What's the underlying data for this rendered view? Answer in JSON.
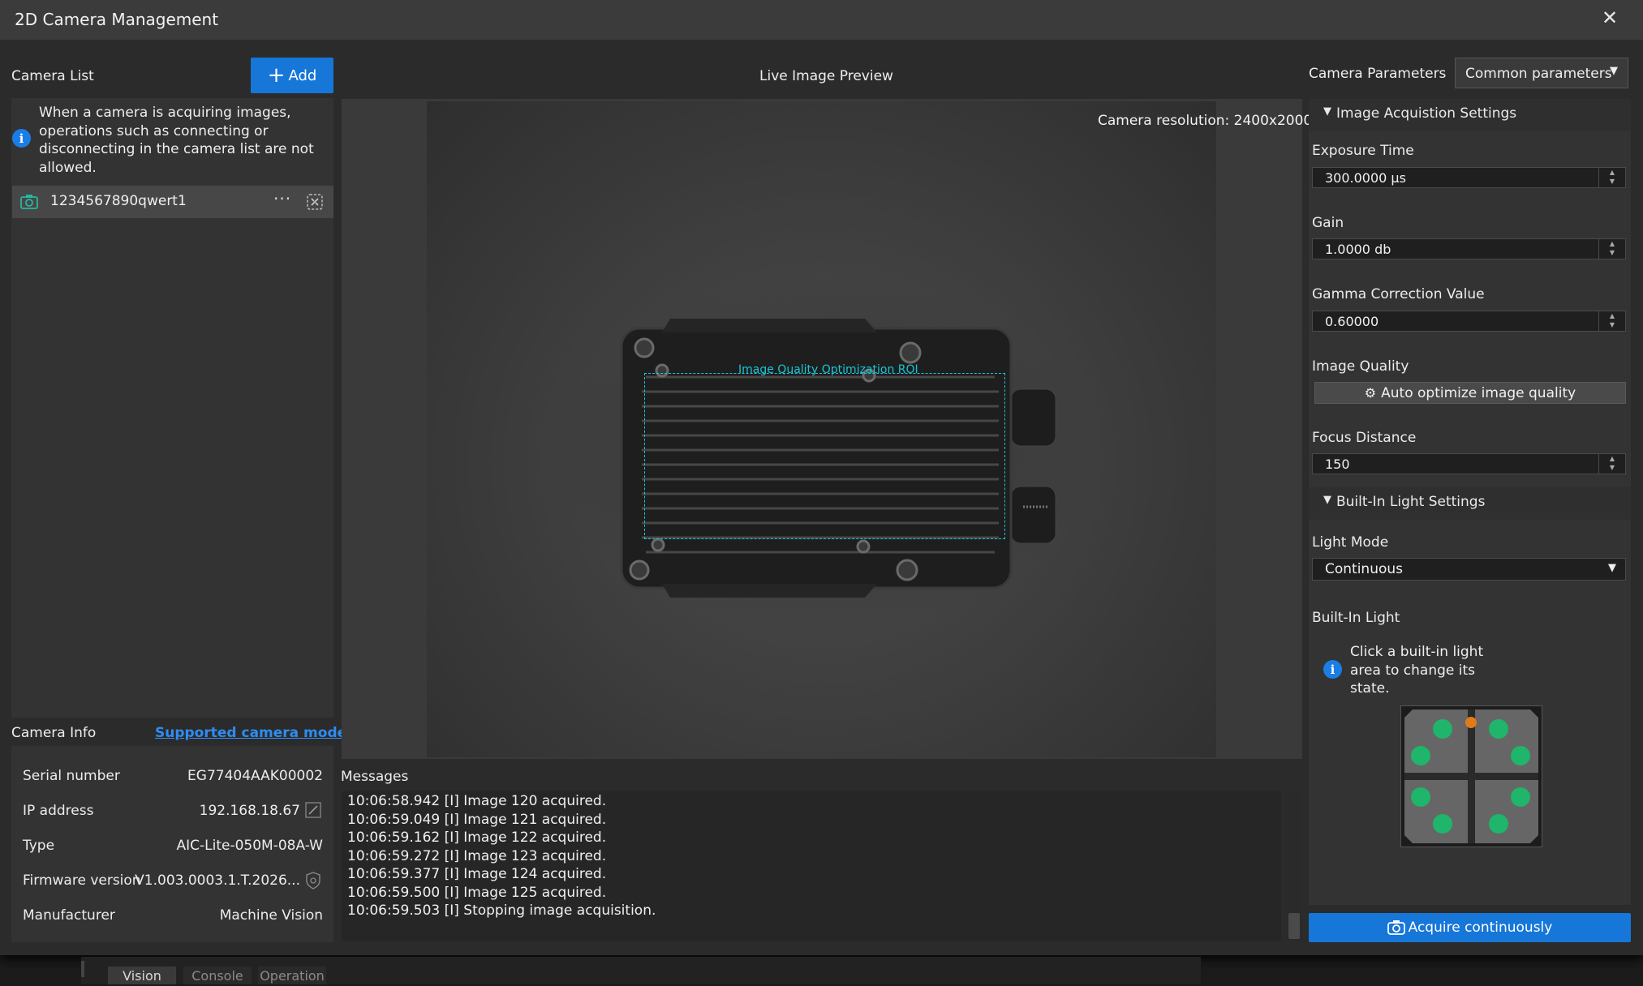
{
  "window": {
    "title": "2D Camera Management"
  },
  "camera_list": {
    "label": "Camera List",
    "add_label": "Add",
    "notice": "When a camera is acquiring images, operations connecting or disconnecting in the camera list are not allowed.",
    "notice_lines": [
      "When a camera is acquiring images,",
      "operations such as connecting or",
      "disconnecting in the camera list are not",
      "allowed."
    ],
    "cameras": [
      {
        "name": "1234567890qwert1"
      }
    ]
  },
  "camera_info": {
    "label": "Camera Info",
    "supported_link": "Supported camera models",
    "rows": [
      {
        "key": "Serial number",
        "value": "EG77404AAK00002"
      },
      {
        "key": "IP address",
        "value": "192.168.18.67"
      },
      {
        "key": "Type",
        "value": "AIC-Lite-050M-08A-W"
      },
      {
        "key": "Firmware version",
        "value": "V1.003.0003.1.T.2026..."
      },
      {
        "key": "Manufacturer",
        "value": "Machine Vision"
      }
    ]
  },
  "preview": {
    "label": "Live Image Preview",
    "resolution": "Camera resolution: 2400x2000",
    "roi_label": "Image Quality Optimization ROI"
  },
  "messages": {
    "label": "Messages",
    "lines": [
      "10:06:58.942 [I] Image 120 acquired.",
      "10:06:59.049 [I] Image 121 acquired.",
      "10:06:59.162 [I] Image 122 acquired.",
      "10:06:59.272 [I] Image 123 acquired.",
      "10:06:59.377 [I] Image 124 acquired.",
      "10:06:59.500 [I] Image 125 acquired.",
      "10:06:59.503 [I] Stopping image acquisition."
    ]
  },
  "parameters": {
    "label": "Camera Parameters",
    "preset": "Common parameters",
    "acq_section": "Image Acquistion Settings",
    "exposure_label": "Exposure Time",
    "exposure_value": "300.0000 μs",
    "gain_label": "Gain",
    "gain_value": "1.0000 db",
    "gamma_label": "Gamma Correction Value",
    "gamma_value": "0.60000",
    "quality_label": "Image Quality",
    "auto_optimize": "Auto optimize image quality",
    "focus_label": "Focus Distance",
    "focus_value": "150",
    "light_section": "Built-In Light Settings",
    "light_mode_label": "Light Mode",
    "light_mode_value": "Continuous",
    "builtin_light_label": "Built-In Light",
    "light_hint_lines": [
      "Click a built-in light",
      "area to change its",
      "state."
    ],
    "acquire_label": "Acquire continuously"
  },
  "background_tabs": [
    "Vision",
    "Console",
    "Operation"
  ],
  "colors": {
    "accent": "#1677d9",
    "roi": "#19c6d6",
    "led_on": "#1fb56a",
    "led_indicator": "#e07b1a"
  }
}
